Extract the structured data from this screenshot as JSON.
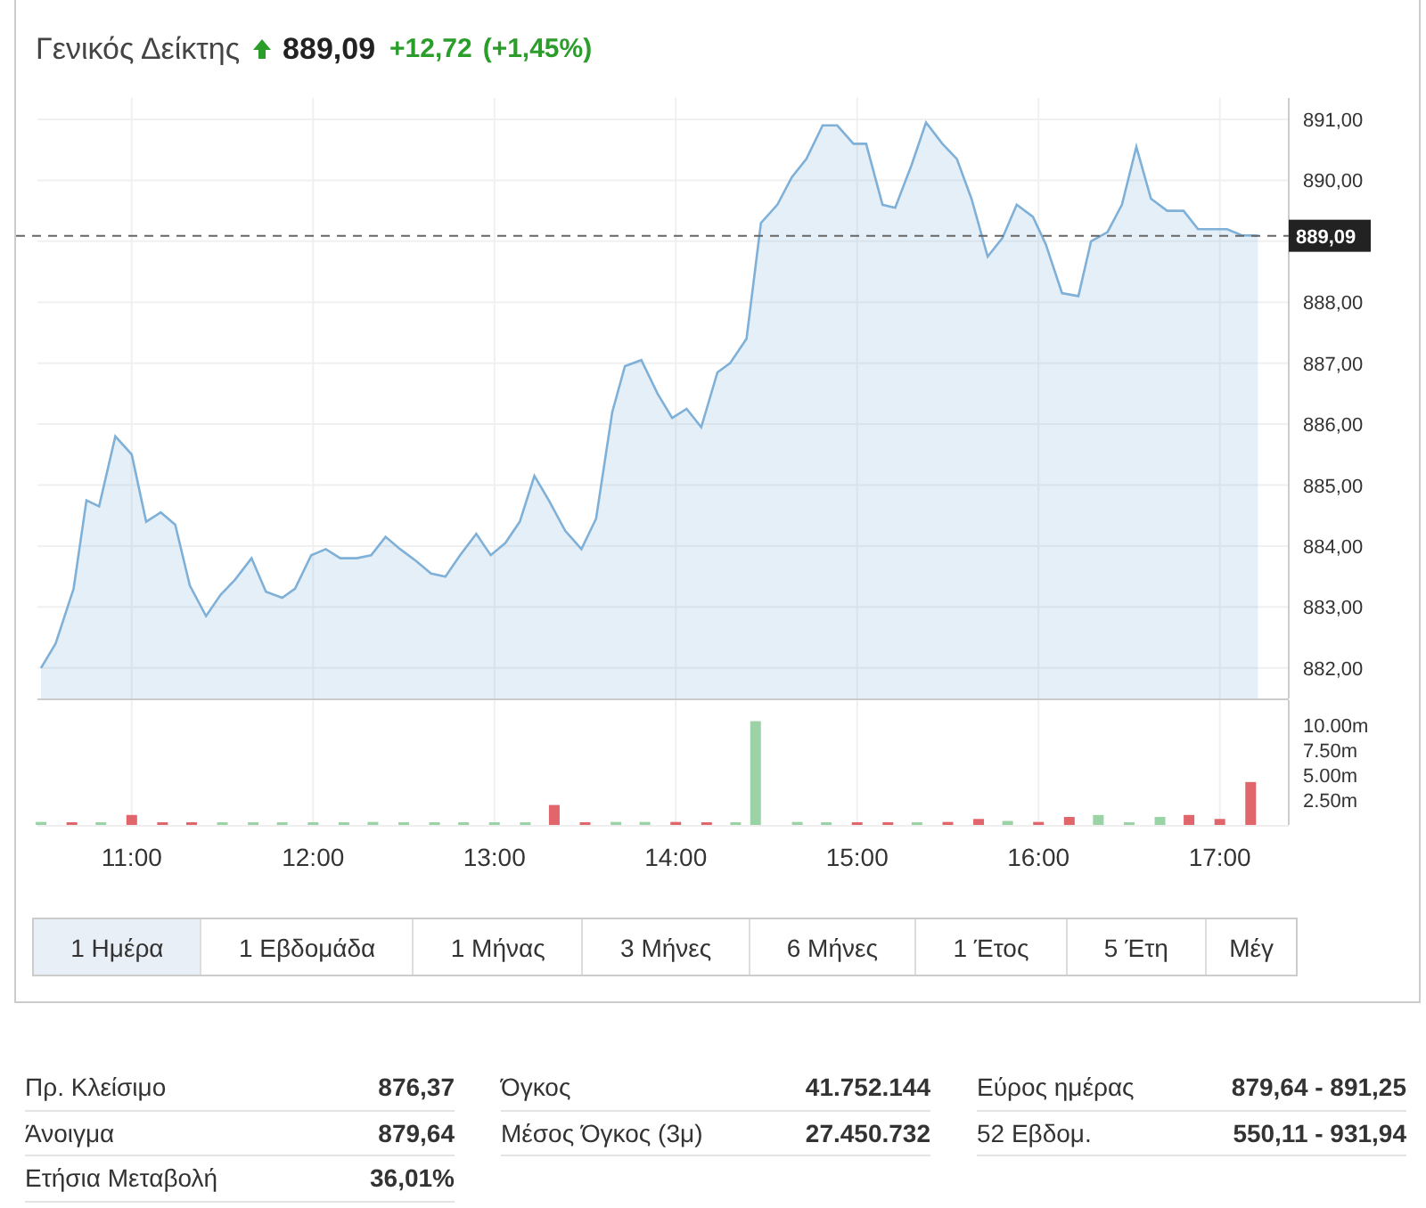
{
  "header": {
    "name": "Γενικός Δείκτης",
    "price": "889,09",
    "change": "+12,72",
    "change_percent": "(+1,45%)"
  },
  "price_chart": {
    "chart_data": {
      "type": "area",
      "grid": true,
      "xlim": [
        10.48,
        17.38
      ],
      "ylim": [
        881.5,
        891.35
      ],
      "yticks": [
        {
          "value": 882,
          "label": "882,00"
        },
        {
          "value": 883,
          "label": "883,00"
        },
        {
          "value": 884,
          "label": "884,00"
        },
        {
          "value": 885,
          "label": "885,00"
        },
        {
          "value": 886,
          "label": "886,00"
        },
        {
          "value": 887,
          "label": "887,00"
        },
        {
          "value": 888,
          "label": "888,00"
        },
        {
          "value": 890,
          "label": "890,00"
        },
        {
          "value": 891,
          "label": "891,00"
        }
      ],
      "x": [
        10.5,
        10.58,
        10.68,
        10.75,
        10.82,
        10.91,
        11.0,
        11.08,
        11.16,
        11.24,
        11.32,
        11.41,
        11.49,
        11.57,
        11.66,
        11.74,
        11.83,
        11.9,
        11.99,
        12.07,
        12.15,
        12.24,
        12.32,
        12.4,
        12.48,
        12.57,
        12.65,
        12.73,
        12.81,
        12.9,
        12.98,
        13.06,
        13.14,
        13.22,
        13.3,
        13.39,
        13.48,
        13.56,
        13.65,
        13.72,
        13.81,
        13.9,
        13.98,
        14.06,
        14.14,
        14.23,
        14.3,
        14.39,
        14.47,
        14.56,
        14.64,
        14.72,
        14.81,
        14.89,
        14.98,
        15.05,
        15.14,
        15.21,
        15.3,
        15.38,
        15.47,
        15.55,
        15.63,
        15.72,
        15.8,
        15.88,
        15.97,
        16.04,
        16.13,
        16.22,
        16.29,
        16.38,
        16.46,
        16.54,
        16.62,
        16.71,
        16.8,
        16.88,
        17.04,
        17.12,
        17.21
      ],
      "series": [
        {
          "color": "#7fb0d8",
          "values": [
            882.0,
            882.4,
            883.3,
            884.75,
            884.65,
            885.8,
            885.5,
            884.4,
            884.55,
            884.35,
            883.35,
            882.85,
            883.2,
            883.45,
            883.8,
            883.25,
            883.15,
            883.3,
            883.85,
            883.95,
            883.8,
            883.8,
            883.85,
            884.15,
            883.95,
            883.75,
            883.55,
            883.5,
            883.85,
            884.2,
            883.85,
            884.05,
            884.4,
            885.15,
            884.75,
            884.25,
            883.95,
            884.45,
            886.2,
            886.95,
            887.05,
            886.5,
            886.1,
            886.25,
            885.95,
            886.85,
            887.0,
            887.4,
            889.3,
            889.6,
            890.05,
            890.35,
            890.9,
            890.9,
            890.6,
            890.6,
            889.6,
            889.55,
            890.25,
            890.95,
            890.6,
            890.35,
            889.7,
            888.75,
            889.05,
            889.6,
            889.4,
            888.95,
            888.15,
            888.1,
            889.0,
            889.15,
            889.6,
            890.55,
            889.7,
            889.5,
            889.5,
            889.2,
            889.2,
            889.1,
            889.09
          ]
        }
      ],
      "ref_lines": [
        {
          "axis": "y",
          "value": 889.09,
          "label": "889,09"
        }
      ]
    }
  },
  "volume_chart": {
    "chart_data": {
      "type": "bar",
      "grid": true,
      "xlim": [
        10.48,
        17.38
      ],
      "ylim": [
        0,
        12.5
      ],
      "yticks": [
        {
          "value": 2.5,
          "label": "2.50m"
        },
        {
          "value": 5,
          "label": "5.00m"
        },
        {
          "value": 7.5,
          "label": "7.50m"
        },
        {
          "value": 10,
          "label": "10.00m"
        }
      ],
      "xticks": [
        {
          "value": 11,
          "label": "11:00"
        },
        {
          "value": 12,
          "label": "12:00"
        },
        {
          "value": 13,
          "label": "13:00"
        },
        {
          "value": 14,
          "label": "14:00"
        },
        {
          "value": 15,
          "label": "15:00"
        },
        {
          "value": 16,
          "label": "16:00"
        },
        {
          "value": 17,
          "label": "17:00"
        }
      ],
      "x": [
        10.5,
        10.67,
        10.83,
        11.0,
        11.17,
        11.33,
        11.5,
        11.67,
        11.83,
        12.0,
        12.17,
        12.33,
        12.5,
        12.67,
        12.83,
        13.0,
        13.17,
        13.33,
        13.5,
        13.67,
        13.83,
        14.0,
        14.17,
        14.33,
        14.44,
        14.67,
        14.83,
        15.0,
        15.17,
        15.33,
        15.5,
        15.67,
        15.83,
        16.0,
        16.17,
        16.33,
        16.5,
        16.67,
        16.83,
        17.0,
        17.17
      ],
      "series": [
        {
          "color": "#9bd3a6",
          "values": [
            0.3,
            null,
            0.2,
            null,
            null,
            null,
            0.1,
            0.1,
            0.1,
            0.1,
            0.1,
            0.3,
            0.1,
            0.1,
            0.2,
            0.1,
            0.1,
            null,
            null,
            0.3,
            0.3,
            null,
            null,
            0.1,
            10.4,
            0.3,
            0.1,
            null,
            null,
            0.2,
            null,
            null,
            0.4,
            null,
            null,
            1.0,
            0.2,
            0.8,
            null,
            null,
            null
          ]
        },
        {
          "color": "#e0666b",
          "values": [
            null,
            0.2,
            null,
            1.0,
            0.2,
            0.2,
            null,
            null,
            null,
            null,
            null,
            null,
            null,
            null,
            null,
            null,
            null,
            2.0,
            0.1,
            null,
            null,
            0.3,
            0.1,
            null,
            null,
            null,
            null,
            0.2,
            0.2,
            null,
            0.3,
            0.6,
            null,
            0.3,
            0.8,
            null,
            null,
            null,
            1.0,
            0.6,
            4.3
          ]
        }
      ]
    }
  },
  "ranges": [
    {
      "label": "1 Ημέρα",
      "selected": true
    },
    {
      "label": "1 Εβδομάδα",
      "selected": false
    },
    {
      "label": "1 Μήνας",
      "selected": false
    },
    {
      "label": "3 Μήνες",
      "selected": false
    },
    {
      "label": "6 Μήνες",
      "selected": false
    },
    {
      "label": "1 Έτος",
      "selected": false
    },
    {
      "label": "5 Έτη",
      "selected": false
    },
    {
      "label": "Μέγ",
      "selected": false
    }
  ],
  "stats": [
    [
      {
        "label": "Πρ. Κλείσιμο",
        "value": "876,37"
      },
      {
        "label": "Άνοιγμα",
        "value": "879,64"
      },
      {
        "label": "Ετήσια Μεταβολή",
        "value": "36,01%"
      }
    ],
    [
      {
        "label": "Όγκος",
        "value": "41.752.144"
      },
      {
        "label": "Μέσος Όγκος (3μ)",
        "value": "27.450.732"
      }
    ],
    [
      {
        "label": "Εύρος ημέρας",
        "value": "879,64 - 891,25"
      },
      {
        "label": "52 Εβδομ.",
        "value": "550,11 - 931,94"
      }
    ]
  ]
}
